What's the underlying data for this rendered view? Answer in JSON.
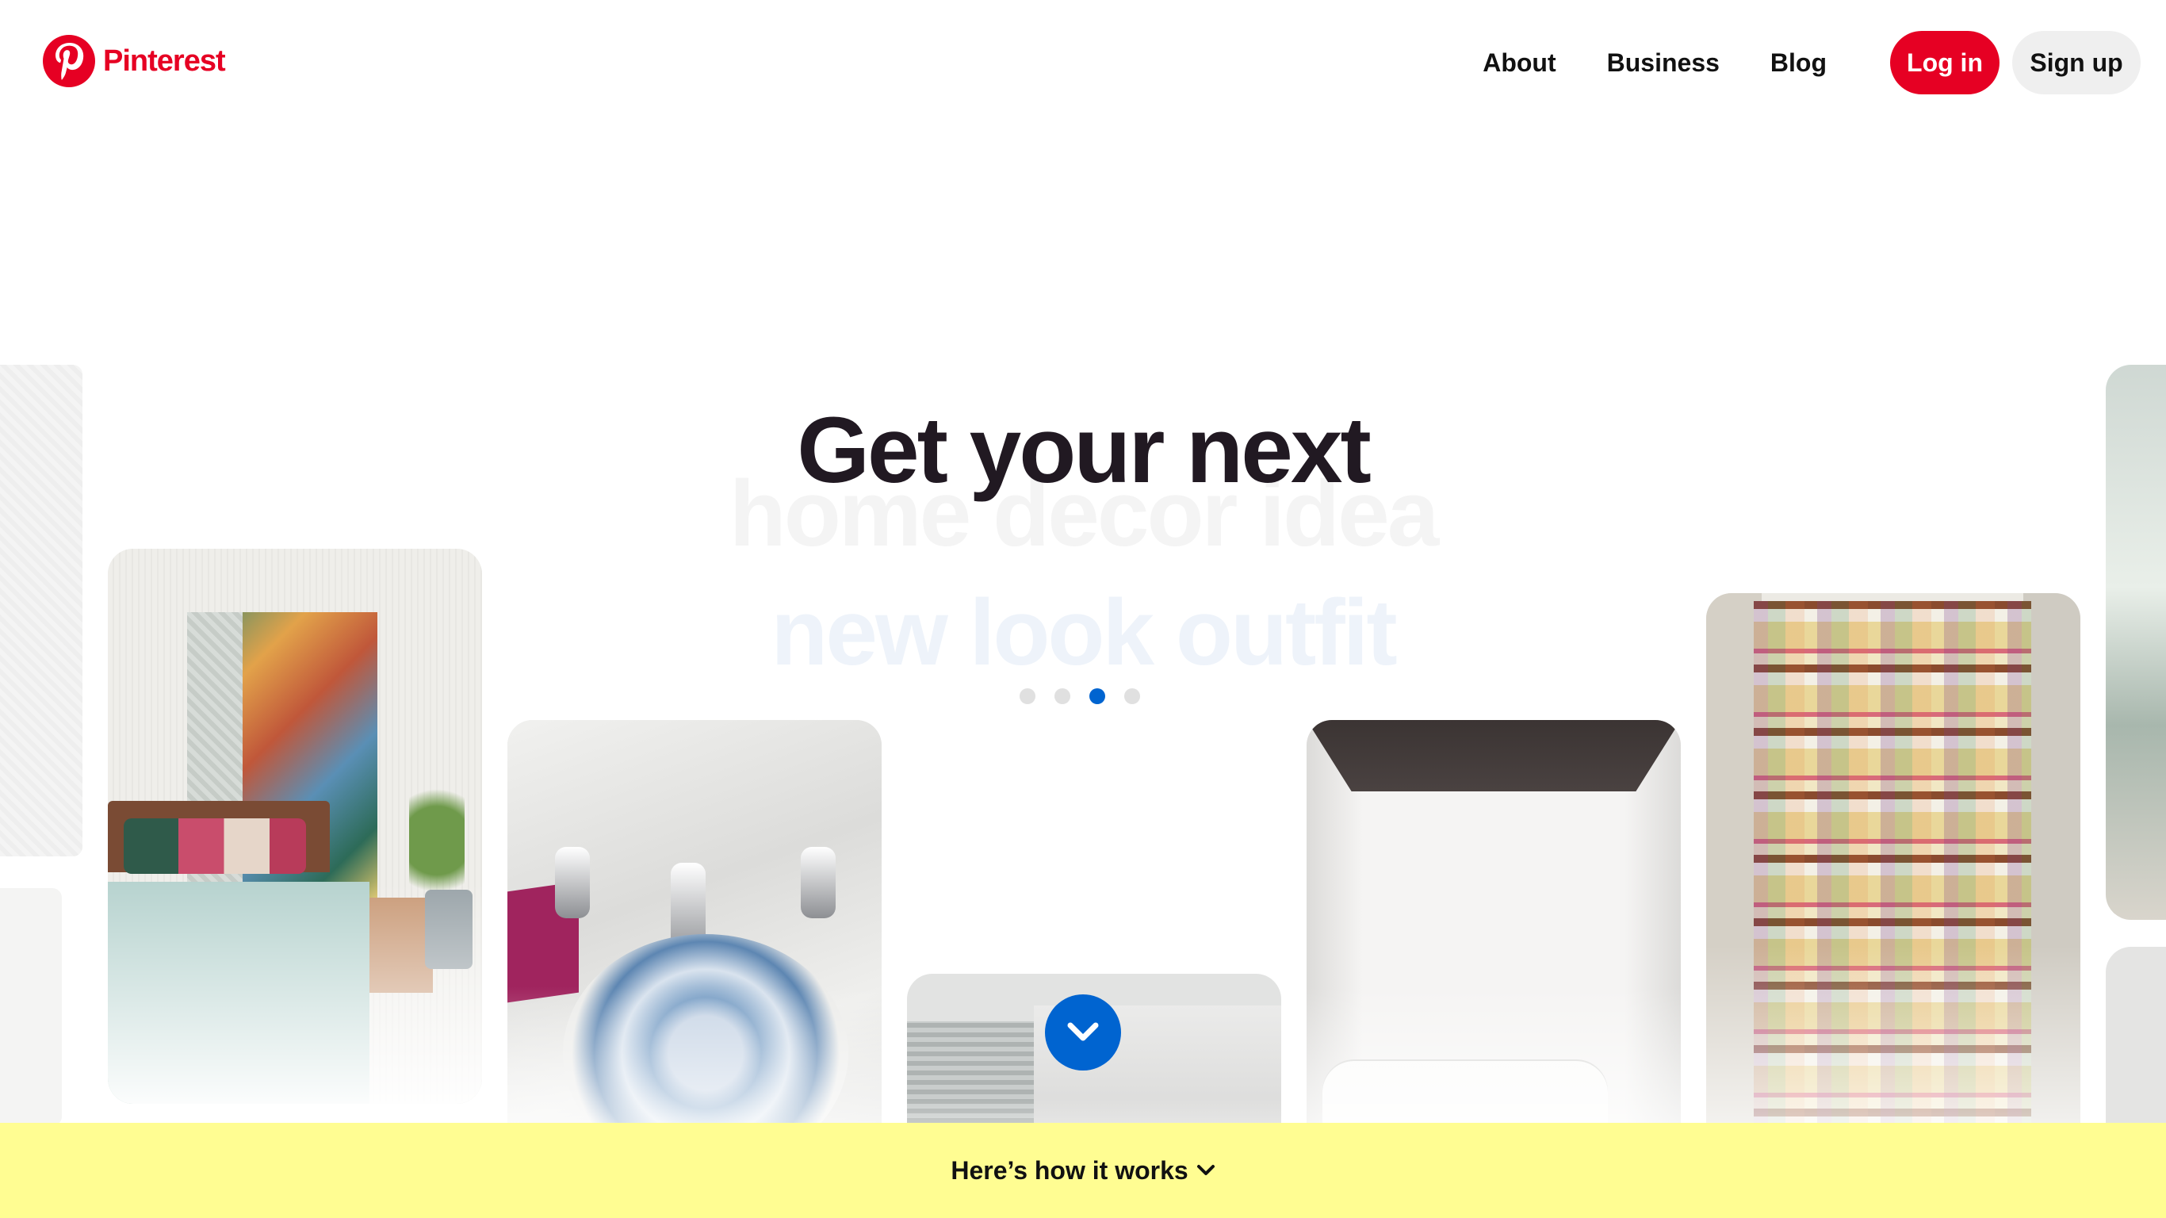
{
  "header": {
    "logo_text": "Pinterest",
    "logo_icon": "pinterest-logo-icon",
    "nav": [
      "About",
      "Business",
      "Blog"
    ],
    "login_label": "Log in",
    "signup_label": "Sign up"
  },
  "hero": {
    "headline": "Get your next",
    "rotating_previous": "home decor idea",
    "rotating_current": "new look outfit",
    "carousel_dots": 4,
    "active_dot_index": 2,
    "scroll_icon": "chevron-down-icon"
  },
  "bottom_bar": {
    "label": "Here’s how it works",
    "icon": "chevron-down-icon"
  },
  "colors": {
    "brand_red": "#e60023",
    "accent_blue": "#0064d0",
    "bar_yellow": "#fffd92",
    "headline": "#211922"
  }
}
